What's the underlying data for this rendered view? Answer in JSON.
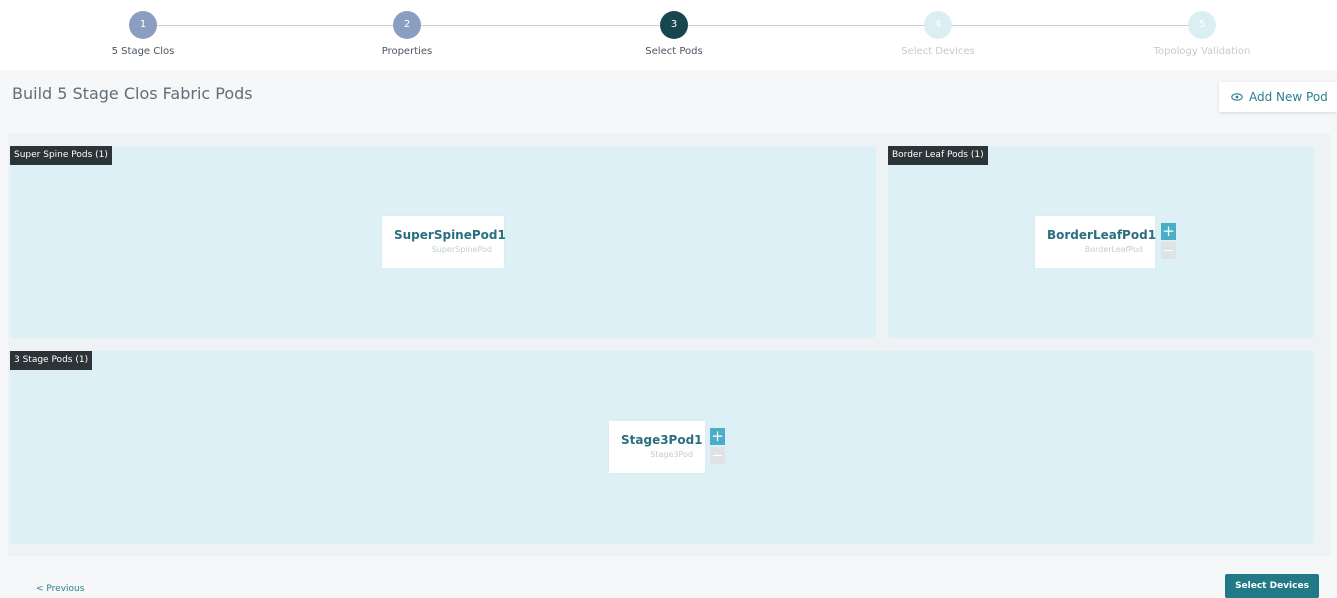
{
  "stepper": {
    "steps": [
      {
        "number": "1",
        "label": "5 Stage Clos",
        "state": "done"
      },
      {
        "number": "2",
        "label": "Properties",
        "state": "done"
      },
      {
        "number": "3",
        "label": "Select Pods",
        "state": "active"
      },
      {
        "number": "4",
        "label": "Select Devices",
        "state": "todo"
      },
      {
        "number": "5",
        "label": "Topology Validation",
        "state": "todo"
      }
    ]
  },
  "page": {
    "title": "Build 5 Stage Clos Fabric Pods",
    "add_pod_label": "Add New Pod",
    "add_pod_icon": "eye-icon"
  },
  "sections": {
    "super_spine": {
      "tag": "Super Spine Pods (1)",
      "pod": {
        "name": "SuperSpinePod1",
        "type": "SuperSpinePod"
      }
    },
    "border_leaf": {
      "tag": "Border Leaf Pods (1)",
      "pod": {
        "name": "BorderLeafPod1",
        "type": "BorderLeafPod"
      },
      "plus": "+"
    },
    "stage3": {
      "tag": "3 Stage Pods (1)",
      "pod": {
        "name": "Stage3Pod1",
        "type": "Stage3Pod"
      },
      "plus": "+"
    }
  },
  "footer": {
    "previous_label": "< Previous",
    "next_label": "Select Devices"
  },
  "colors": {
    "accent": "#227a86",
    "active_step": "#17464f",
    "done_step": "#8b9dc0",
    "section_bg": "#dcf0f5",
    "plus_button": "#4aaec8"
  }
}
